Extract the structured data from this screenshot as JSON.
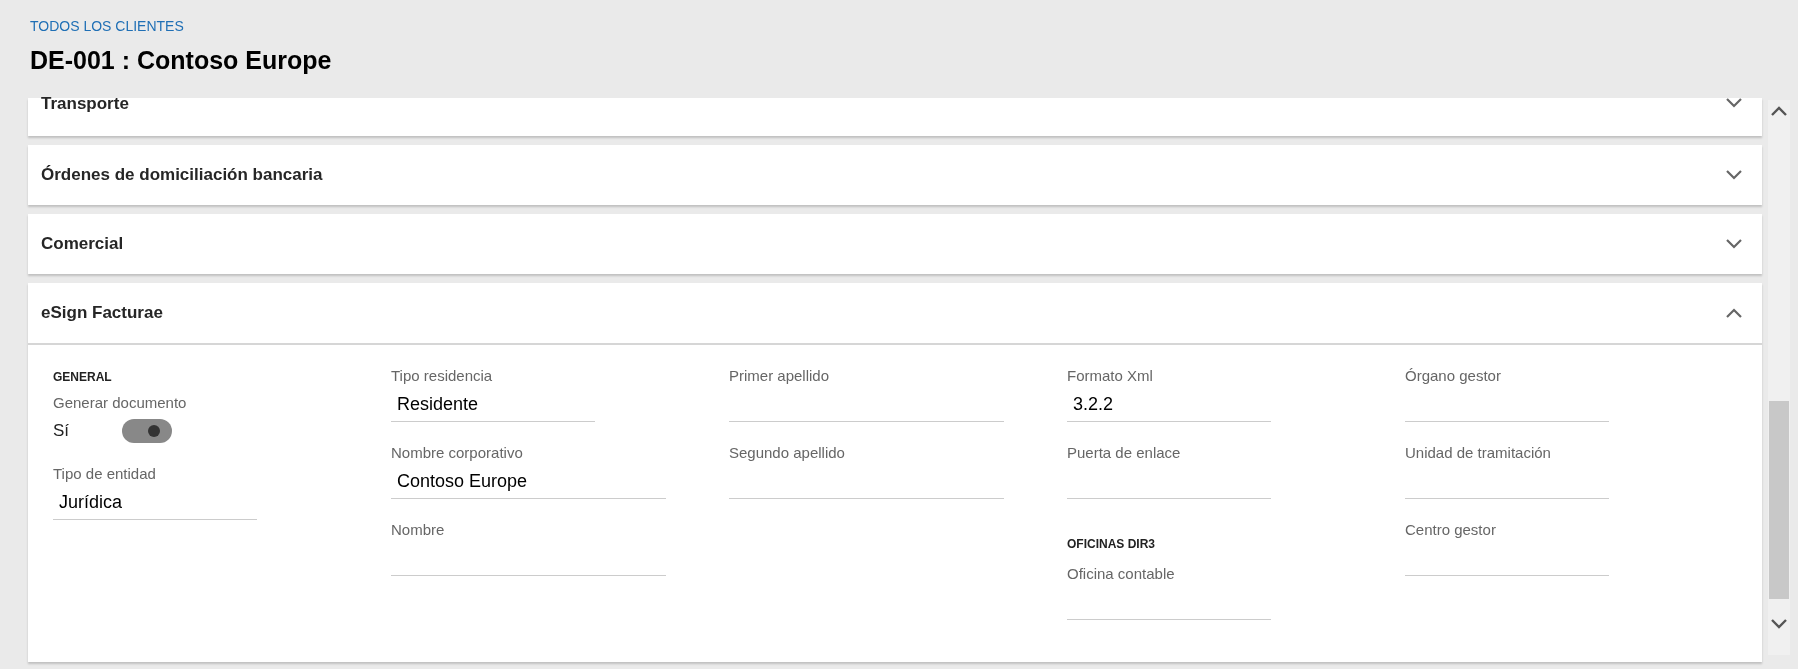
{
  "breadcrumb": "TODOS LOS CLIENTES",
  "title": "DE-001 : Contoso Europe",
  "sections": [
    {
      "title": "Transporte",
      "expanded": false
    },
    {
      "title": "Órdenes de domiciliación bancaria",
      "expanded": false
    },
    {
      "title": "Comercial",
      "expanded": false
    },
    {
      "title": "eSign Facturae",
      "expanded": true,
      "columns": [
        [
          {
            "kind": "heading",
            "text": "GENERAL"
          },
          {
            "kind": "toggle",
            "label": "Generar documento",
            "value": "Sí",
            "on": true
          },
          {
            "kind": "select",
            "label": "Tipo de entidad",
            "value": "Jurídica"
          }
        ],
        [
          {
            "kind": "select",
            "label": "Tipo residencia",
            "value": "Residente"
          },
          {
            "kind": "text",
            "label": "Nombre corporativo",
            "value": "Contoso Europe"
          },
          {
            "kind": "text",
            "label": "Nombre"
          }
        ],
        [
          {
            "kind": "text",
            "label": "Primer apellido"
          },
          {
            "kind": "text",
            "label": "Segundo apellido"
          }
        ],
        [
          {
            "kind": "select",
            "label": "Formato Xml",
            "value": "3.2.2"
          },
          {
            "kind": "select",
            "label": "Puerta de enlace"
          },
          {
            "kind": "heading",
            "text": "OFICINAS DIR3"
          },
          {
            "kind": "select",
            "label": "Oficina contable"
          }
        ],
        [
          {
            "kind": "select",
            "label": "Órgano gestor"
          },
          {
            "kind": "select",
            "label": "Unidad de tramitación"
          },
          {
            "kind": "select",
            "label": "Centro gestor"
          }
        ]
      ]
    }
  ]
}
